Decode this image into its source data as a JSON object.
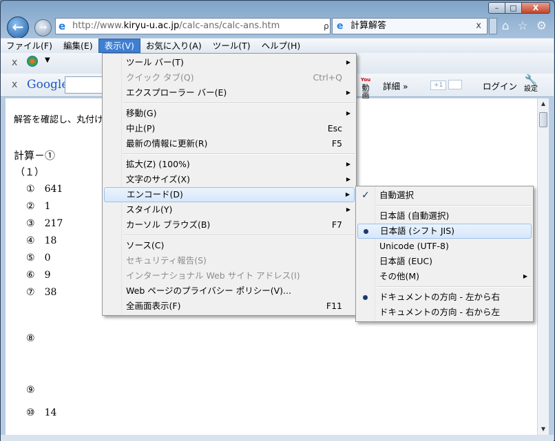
{
  "window": {
    "minimize": "–",
    "maximize": "□",
    "close": "X"
  },
  "nav": {
    "back_glyph": "←",
    "forward_glyph": "→",
    "url_prefix": "http://www.",
    "url_domain": "kiryu-u.ac.jp",
    "url_path": "/calc-ans/calc-ans.htm",
    "addr_tools": [
      "ρ",
      "▾",
      "☒",
      "↻",
      "✕"
    ],
    "tab_title": "計算解答",
    "tab_close": "x",
    "home_glyph": "⌂",
    "fav_glyph": "☆",
    "tools_glyph": "⚙"
  },
  "menubar": [
    "ファイル(F)",
    "編集(E)",
    "表示(V)",
    "お気に入り(A)",
    "ツール(T)",
    "ヘルプ(H)"
  ],
  "google_bar": {
    "close": "x",
    "logo": "Google",
    "video": "動画",
    "details": "詳細 »",
    "plus": "+1",
    "login": "ログイン",
    "settings": "設定"
  },
  "content": {
    "intro": "解答を確認し、丸付け",
    "heading": "計算－①",
    "subheading": "（１）",
    "answers": [
      {
        "num": "①",
        "value": "641"
      },
      {
        "num": "②",
        "value": "1"
      },
      {
        "num": "③",
        "value": "217"
      },
      {
        "num": "④",
        "value": "18"
      },
      {
        "num": "⑤",
        "value": "0"
      },
      {
        "num": "⑥",
        "value": "9"
      },
      {
        "num": "⑦",
        "value": "38"
      },
      {
        "num": "⑧",
        "value": ""
      },
      {
        "num": "⑨",
        "value": ""
      },
      {
        "num": "⑩",
        "value": "14"
      }
    ]
  },
  "view_menu": {
    "items": [
      {
        "label": "ツール バー(T)",
        "arrow": "▶"
      },
      {
        "label": "クイック タブ(Q)",
        "shortcut": "Ctrl+Q"
      },
      {
        "label": "エクスプローラー バー(E)",
        "arrow": "▶"
      },
      {
        "label": "移動(G)",
        "arrow": "▶"
      },
      {
        "label": "中止(P)",
        "shortcut": "Esc"
      },
      {
        "label": "最新の情報に更新(R)",
        "shortcut": "F5"
      },
      {
        "label": "拡大(Z) (100%)",
        "arrow": "▶"
      },
      {
        "label": "文字のサイズ(X)",
        "arrow": "▶"
      },
      {
        "label": "エンコード(D)",
        "arrow": "▶"
      },
      {
        "label": "スタイル(Y)",
        "arrow": "▶"
      },
      {
        "label": "カーソル ブラウズ(B)",
        "shortcut": "F7"
      },
      {
        "label": "ソース(C)"
      },
      {
        "label": "セキュリティ報告(S)"
      },
      {
        "label": "インターナショナル Web サイト アドレス(I)"
      },
      {
        "label": "Web ページのプライバシー ポリシー(V)..."
      },
      {
        "label": "全画面表示(F)",
        "shortcut": "F11"
      }
    ]
  },
  "encoding_menu": {
    "check": "✓",
    "items": [
      {
        "label": "自動選択"
      },
      {
        "label": "日本語 (自動選択)"
      },
      {
        "label": "日本語 (シフト JIS)"
      },
      {
        "label": "Unicode (UTF-8)"
      },
      {
        "label": "日本語 (EUC)"
      },
      {
        "label": "その他(M)",
        "arrow": "▶"
      },
      {
        "label": "ドキュメントの方向 - 左から右"
      },
      {
        "label": "ドキュメントの方向 - 右から左"
      }
    ]
  },
  "scrollbar": {
    "up": "▲",
    "down": "▼"
  }
}
